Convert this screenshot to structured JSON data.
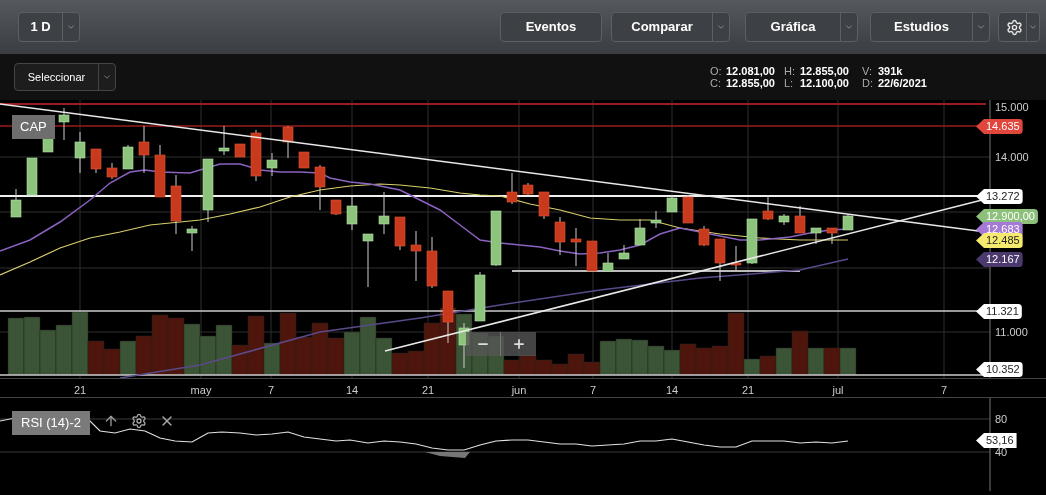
{
  "toolbar": {
    "period": {
      "label": "1 D",
      "kind": "dropdown"
    },
    "buttons": [
      {
        "label": "Eventos",
        "kind": "plain"
      },
      {
        "label": "Comparar",
        "kind": "dropdown"
      },
      {
        "label": "Gráfica",
        "kind": "dropdown"
      },
      {
        "label": "Estudios",
        "kind": "dropdown"
      },
      {
        "kind": "settings"
      }
    ]
  },
  "selector": {
    "label": "Seleccionar"
  },
  "quote": [
    {
      "label": "O:",
      "value": "12.081,00"
    },
    {
      "label": "H:",
      "value": "12.855,00"
    },
    {
      "label": "V:",
      "value": "391k"
    },
    {
      "label": "C:",
      "value": "12.855,00"
    },
    {
      "label": "L:",
      "value": "12.100,00"
    },
    {
      "label": "D:",
      "value": "22/6/2021"
    }
  ],
  "chart": {
    "symbol": "CAP",
    "price_axis": [
      "15.000",
      "14.000",
      "11.000"
    ],
    "price_tags": [
      {
        "value": "14.635",
        "color": "#e0463c"
      },
      {
        "value": "13.272",
        "color": "#ffffff"
      },
      {
        "value": "12.900,00",
        "color": "#8dc07a"
      },
      {
        "value": "12.683",
        "color": "#a47ad6"
      },
      {
        "value": "12.485",
        "color": "#f6ea6e"
      },
      {
        "value": "12.167",
        "color": "#4c3a6e"
      },
      {
        "value": "11.321",
        "color": "#ffffff"
      },
      {
        "value": "10.352",
        "color": "#ffffff"
      }
    ],
    "date_axis": [
      "21",
      "may",
      "7",
      "14",
      "21",
      "jun",
      "7",
      "14",
      "21",
      "jul",
      "7"
    ]
  },
  "rsi": {
    "label": "RSI (14)-2",
    "axis": [
      "80",
      "40"
    ],
    "tag": "53,16"
  }
}
